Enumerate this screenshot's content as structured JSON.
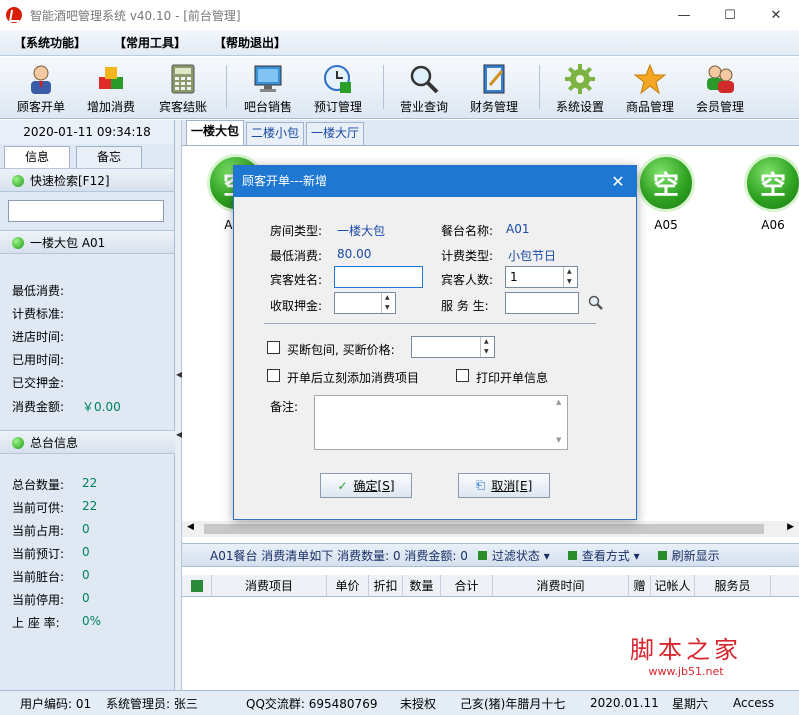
{
  "window": {
    "title": "智能酒吧管理系统 v40.10 - [前台管理]",
    "controls": [
      "—",
      "☐",
      "✕"
    ]
  },
  "menu": [
    "【系统功能】",
    "【常用工具】",
    "【帮助退出】"
  ],
  "toolbar": [
    {
      "label": "顾客开单",
      "icon": "customer-icon"
    },
    {
      "label": "增加消费",
      "icon": "cubes-icon"
    },
    {
      "label": "宾客结账",
      "icon": "calculator-icon"
    },
    {
      "label": "吧台销售",
      "icon": "monitor-icon"
    },
    {
      "label": "预订管理",
      "icon": "clock-icon"
    },
    {
      "label": "营业查询",
      "icon": "magnifier-icon"
    },
    {
      "label": "财务管理",
      "icon": "notebook-icon"
    },
    {
      "label": "系统设置",
      "icon": "gear-icon"
    },
    {
      "label": "商品管理",
      "icon": "star-icon"
    },
    {
      "label": "会员管理",
      "icon": "members-icon"
    }
  ],
  "left": {
    "datetime": "2020-01-11 09:34:18",
    "tabs": [
      "信息",
      "备忘"
    ],
    "quick_search": "快速检索[F12]",
    "room_header": "一楼大包  A01",
    "room_info": [
      {
        "label": "最低消费:",
        "value": ""
      },
      {
        "label": "计费标准:",
        "value": ""
      },
      {
        "label": "进店时间:",
        "value": ""
      },
      {
        "label": "已用时间:",
        "value": ""
      },
      {
        "label": "已交押金:",
        "value": ""
      },
      {
        "label": "消费金额:",
        "value": "￥0.00"
      }
    ],
    "summary_header": "总台信息",
    "summary": [
      {
        "label": "总台数量:",
        "value": "22"
      },
      {
        "label": "当前可供:",
        "value": "22"
      },
      {
        "label": "当前占用:",
        "value": "0"
      },
      {
        "label": "当前预订:",
        "value": "0"
      },
      {
        "label": "当前脏台:",
        "value": "0"
      },
      {
        "label": "当前停用:",
        "value": "0"
      },
      {
        "label": "上 座 率:",
        "value": "0%"
      }
    ]
  },
  "room_tabs": [
    "一楼大包",
    "二楼小包",
    "一楼大厅"
  ],
  "rooms": [
    {
      "name": "A01",
      "status": "空"
    },
    {
      "name": "A05",
      "status": "空"
    },
    {
      "name": "A06",
      "status": "空"
    }
  ],
  "status_line": {
    "text": "A01餐台   消费清单如下    消费数量:  0   消费金额:  0",
    "filter": "过滤状态 ▾",
    "view": "查看方式 ▾",
    "refresh": "刷新显示"
  },
  "grid_columns": [
    "消费项目",
    "单价",
    "折扣",
    "数量",
    "合计",
    "消费时间",
    "赠",
    "记帐人",
    "服务员"
  ],
  "bottom_bar": {
    "user_code": "用户编码:  01",
    "manager": "系统管理员:  张三",
    "qq": "QQ交流群:  695480769",
    "license": "未授权",
    "lunar": "己亥(猪)年腊月十七",
    "date": "2020.01.11",
    "weekday": "星期六",
    "db": "Access"
  },
  "watermark": {
    "big": "脚本之家",
    "small": "www.jb51.net"
  },
  "dialog": {
    "title": "顾客开单---新增",
    "room_type_label": "房间类型:",
    "room_type": "一楼大包",
    "table_name_label": "餐台名称:",
    "table_name": "A01",
    "min_consume_label": "最低消费:",
    "min_consume": "80.00",
    "billing_type_label": "计费类型:",
    "billing_type": "小包节日",
    "guest_name_label": "宾客姓名:",
    "guest_name": "",
    "guest_count_label": "宾客人数:",
    "guest_count": "1",
    "deposit_label": "收取押金:",
    "deposit": "",
    "waiter_label": "服 务 生:",
    "waiter": "",
    "buyout_label": "买断包间, 买断价格:",
    "buyout_price": "",
    "add_items_label": "开单后立刻添加消费项目",
    "print_label": "打印开单信息",
    "remark_label": "备注:",
    "ok": "确定[S]",
    "cancel": "取消[E]"
  }
}
